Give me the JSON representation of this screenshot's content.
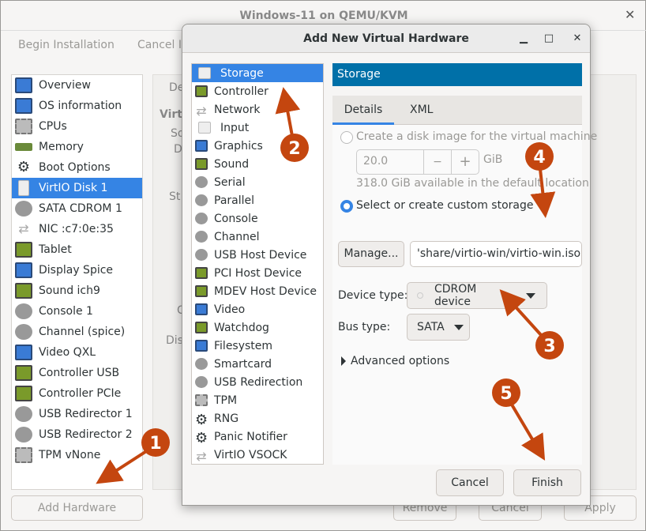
{
  "main_window": {
    "title": "Windows-11 on QEMU/KVM",
    "toolbar": {
      "begin_installation": "Begin Installation",
      "cancel_installation": "Cancel In"
    },
    "sidebar": [
      {
        "label": "Overview",
        "icon": "monitor"
      },
      {
        "label": "OS information",
        "icon": "monitor"
      },
      {
        "label": "CPUs",
        "icon": "chip"
      },
      {
        "label": "Memory",
        "icon": "ram"
      },
      {
        "label": "Boot Options",
        "icon": "gear"
      },
      {
        "label": "VirtIO Disk 1",
        "icon": "disk",
        "selected": true
      },
      {
        "label": "SATA CDROM 1",
        "icon": "cdrom"
      },
      {
        "label": "NIC :c7:0e:35",
        "icon": "network"
      },
      {
        "label": "Tablet",
        "icon": "tablet"
      },
      {
        "label": "Display Spice",
        "icon": "monitor"
      },
      {
        "label": "Sound ich9",
        "icon": "sound"
      },
      {
        "label": "Console 1",
        "icon": "serial"
      },
      {
        "label": "Channel (spice)",
        "icon": "serial"
      },
      {
        "label": "Video QXL",
        "icon": "monitor"
      },
      {
        "label": "Controller USB",
        "icon": "card"
      },
      {
        "label": "Controller PCIe",
        "icon": "card"
      },
      {
        "label": "USB Redirector 1",
        "icon": "usb"
      },
      {
        "label": "USB Redirector 2",
        "icon": "usb"
      },
      {
        "label": "TPM vNone",
        "icon": "chip"
      }
    ],
    "background_fragments": {
      "tab": "De",
      "virt": "Virtu",
      "so": "So",
      "de": "De",
      "st": "St",
      "a": "A",
      "c": "C",
      "dis": "Dis"
    },
    "add_hardware": "Add Hardware",
    "remove": "Remove",
    "cancel": "Cancel",
    "apply": "Apply"
  },
  "dialog": {
    "title": "Add New Virtual Hardware",
    "hardware_types": [
      {
        "label": "Storage",
        "icon": "disk",
        "selected": true
      },
      {
        "label": "Controller",
        "icon": "card"
      },
      {
        "label": "Network",
        "icon": "network"
      },
      {
        "label": "Input",
        "icon": "mouse"
      },
      {
        "label": "Graphics",
        "icon": "monitor"
      },
      {
        "label": "Sound",
        "icon": "sound"
      },
      {
        "label": "Serial",
        "icon": "serial"
      },
      {
        "label": "Parallel",
        "icon": "serial"
      },
      {
        "label": "Console",
        "icon": "serial"
      },
      {
        "label": "Channel",
        "icon": "serial"
      },
      {
        "label": "USB Host Device",
        "icon": "usb"
      },
      {
        "label": "PCI Host Device",
        "icon": "card"
      },
      {
        "label": "MDEV Host Device",
        "icon": "card"
      },
      {
        "label": "Video",
        "icon": "monitor"
      },
      {
        "label": "Watchdog",
        "icon": "card"
      },
      {
        "label": "Filesystem",
        "icon": "folder"
      },
      {
        "label": "Smartcard",
        "icon": "serial"
      },
      {
        "label": "USB Redirection",
        "icon": "usb"
      },
      {
        "label": "TPM",
        "icon": "chip"
      },
      {
        "label": "RNG",
        "icon": "gear"
      },
      {
        "label": "Panic Notifier",
        "icon": "gear"
      },
      {
        "label": "VirtIO VSOCK",
        "icon": "network"
      }
    ],
    "section_header": "Storage",
    "tabs": [
      "Details",
      "XML"
    ],
    "create_disk_label": "Create a disk image for the virtual machine",
    "disk_size": "20.0",
    "size_unit": "GiB",
    "available": "318.0 GiB available in the default location",
    "custom_storage_label": "Select or create custom storage",
    "manage": "Manage...",
    "storage_path": "'share/virtio-win/virtio-win.iso",
    "device_type_label": "Device type:",
    "device_type": "CDROM device",
    "bus_type_label": "Bus type:",
    "bus_type": "SATA",
    "advanced": "Advanced options",
    "cancel": "Cancel",
    "finish": "Finish"
  },
  "annotations": {
    "color": "#c4460f",
    "labels": [
      "1",
      "2",
      "3",
      "4",
      "5"
    ]
  },
  "colors": {
    "selection": "#3584e4",
    "header": "#0070a8"
  }
}
